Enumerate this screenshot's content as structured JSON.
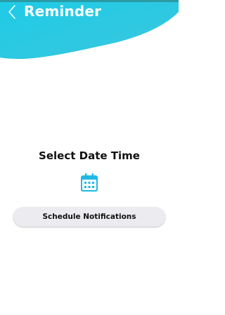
{
  "header": {
    "title": "Reminder",
    "back_icon": "chevron-left-icon",
    "colors": {
      "gradient_start": "#1ecbe6",
      "gradient_end": "#36c7e0",
      "strip": "#2a9aa6"
    }
  },
  "main": {
    "heading": "Select Date Time",
    "calendar_icon": "calendar-icon",
    "calendar_color": "#21b8e3",
    "schedule_button_label": "Schedule Notifications"
  }
}
